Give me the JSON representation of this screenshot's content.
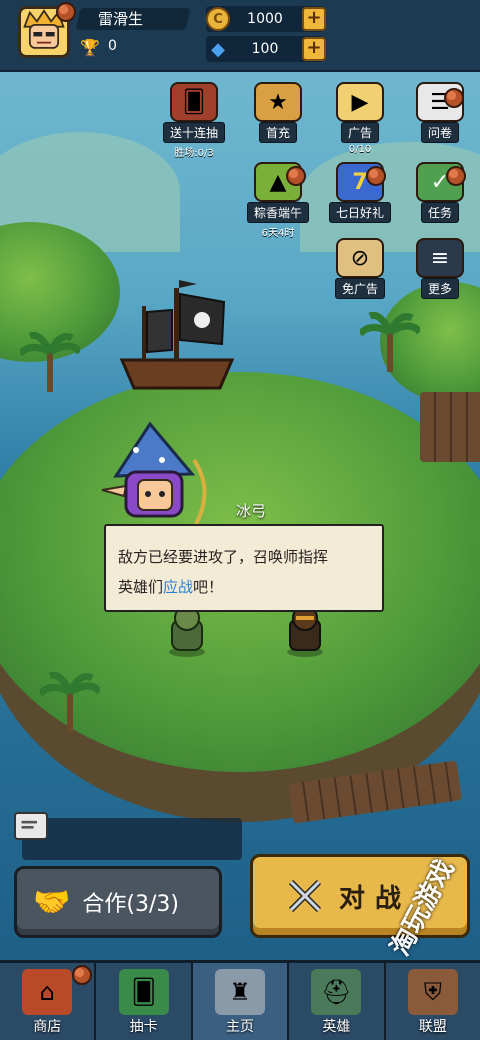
{
  "player": {
    "name": "雷滑生",
    "trophies": "0"
  },
  "resources": {
    "gold": "1000",
    "diamonds": "100"
  },
  "features": [
    {
      "label": "送十连抽",
      "sub": "胜场:0/3",
      "icon": "card-pack-icon"
    },
    {
      "label": "首充",
      "sub": "",
      "icon": "treasure-chest-icon"
    },
    {
      "label": "广告",
      "sub": "0/10",
      "icon": "tv-icon"
    },
    {
      "label": "问卷",
      "sub": "",
      "icon": "questionnaire-icon"
    },
    {
      "label": "粽香端午",
      "sub": "6天4时",
      "icon": "zongzi-icon"
    },
    {
      "label": "七日好礼",
      "sub": "",
      "icon": "seven-day-icon"
    },
    {
      "label": "任务",
      "sub": "",
      "icon": "task-icon"
    },
    {
      "label": "免广告",
      "sub": "",
      "icon": "no-ads-icon"
    },
    {
      "label": "更多",
      "sub": "",
      "icon": "menu-icon"
    }
  ],
  "dialog": {
    "speaker": "冰弓",
    "line1": "敌方已经要进攻了，召唤师指挥",
    "line2_a": "英雄们",
    "line2_hl": "应战",
    "line2_b": "吧！"
  },
  "buttons": {
    "coop": "合作(3/3)",
    "battle": "对战"
  },
  "nav": [
    {
      "label": "商店"
    },
    {
      "label": "抽卡"
    },
    {
      "label": "主页"
    },
    {
      "label": "英雄"
    },
    {
      "label": "联盟"
    }
  ],
  "watermark": "淘玩游戏",
  "colors": {
    "highlight": "#2a7fd4",
    "battle": "#e7b84a",
    "coop": "#4b5560",
    "nav": "#2b4a66"
  }
}
